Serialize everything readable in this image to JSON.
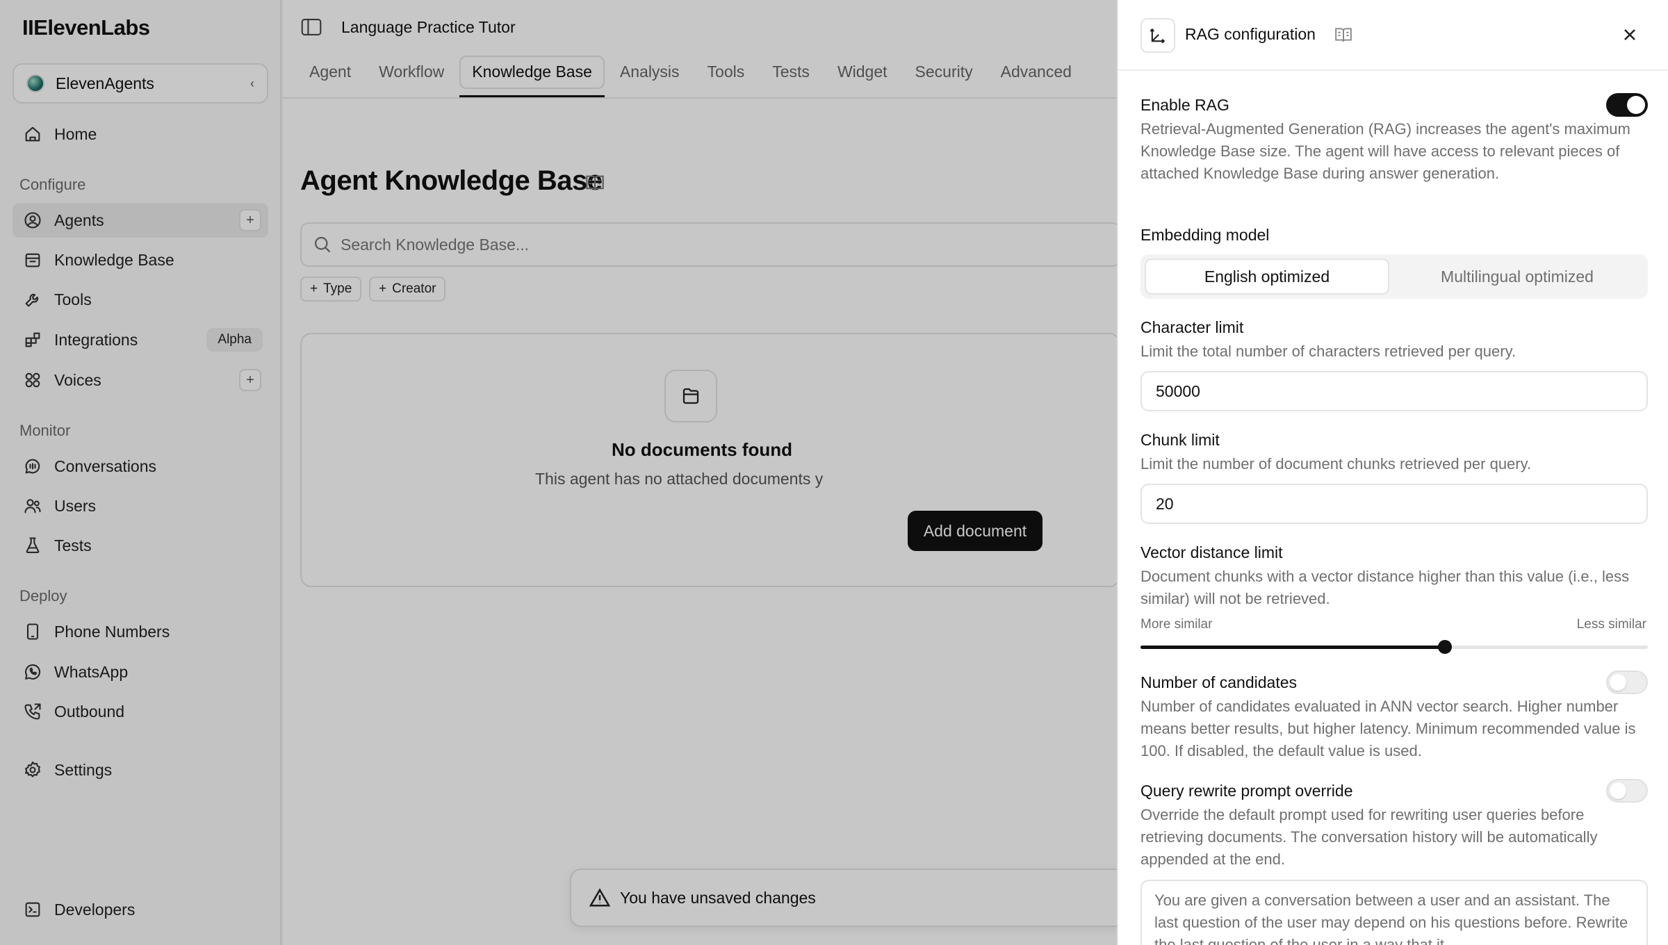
{
  "app": {
    "brand": "IIElevenLabs"
  },
  "workspace": {
    "name": "ElevenAgents"
  },
  "sidebar": {
    "home": "Home",
    "sections": {
      "configure": "Configure",
      "monitor": "Monitor",
      "deploy": "Deploy"
    },
    "items": {
      "agents": "Agents",
      "knowledge_base": "Knowledge Base",
      "tools": "Tools",
      "integrations": "Integrations",
      "integrations_badge": "Alpha",
      "voices": "Voices",
      "conversations": "Conversations",
      "users": "Users",
      "tests": "Tests",
      "phone_numbers": "Phone Numbers",
      "whatsapp": "WhatsApp",
      "outbound": "Outbound",
      "settings": "Settings",
      "developers": "Developers"
    }
  },
  "header": {
    "agent_name": "Language Practice Tutor"
  },
  "tabs": [
    "Agent",
    "Workflow",
    "Knowledge Base",
    "Analysis",
    "Tools",
    "Tests",
    "Widget",
    "Security",
    "Advanced"
  ],
  "active_tab": "Knowledge Base",
  "knowledge_base": {
    "title": "Agent Knowledge Base",
    "search_placeholder": "Search Knowledge Base...",
    "filters": {
      "type": "Type",
      "creator": "Creator"
    },
    "empty_title": "No documents found",
    "empty_sub": "This agent has no attached documents y",
    "add_button": "Add document"
  },
  "toast": {
    "text": "You have unsaved changes"
  },
  "rag_panel": {
    "title": "RAG configuration",
    "enable": {
      "label": "Enable RAG",
      "enabled": true,
      "description": "Retrieval-Augmented Generation (RAG) increases the agent's maximum Knowledge Base size. The agent will have access to relevant pieces of attached Knowledge Base during answer generation."
    },
    "embedding": {
      "label": "Embedding model",
      "options": [
        "English optimized",
        "Multilingual optimized"
      ],
      "selected": "English optimized"
    },
    "character_limit": {
      "label": "Character limit",
      "description": "Limit the total number of characters retrieved per query.",
      "value": "50000"
    },
    "chunk_limit": {
      "label": "Chunk limit",
      "description": "Limit the number of document chunks retrieved per query.",
      "value": "20"
    },
    "vector_distance": {
      "label": "Vector distance limit",
      "description": "Document chunks with a vector distance higher than this value (i.e., less similar) will not be retrieved.",
      "min_label": "More similar",
      "max_label": "Less similar",
      "level": 0.6
    },
    "candidates": {
      "label": "Number of candidates",
      "enabled": false,
      "description": "Number of candidates evaluated in ANN vector search. Higher number means better results, but higher latency. Minimum recommended value is 100. If disabled, the default value is used."
    },
    "query_rewrite": {
      "label": "Query rewrite prompt override",
      "enabled": false,
      "description": "Override the default prompt used for rewriting user queries before retrieving documents. The conversation history will be automatically appended at the end.",
      "prompt": "You are given a conversation between a user and an assistant. The last question of the user may depend on his questions before. Rewrite the last question of the user in a way that it"
    }
  }
}
